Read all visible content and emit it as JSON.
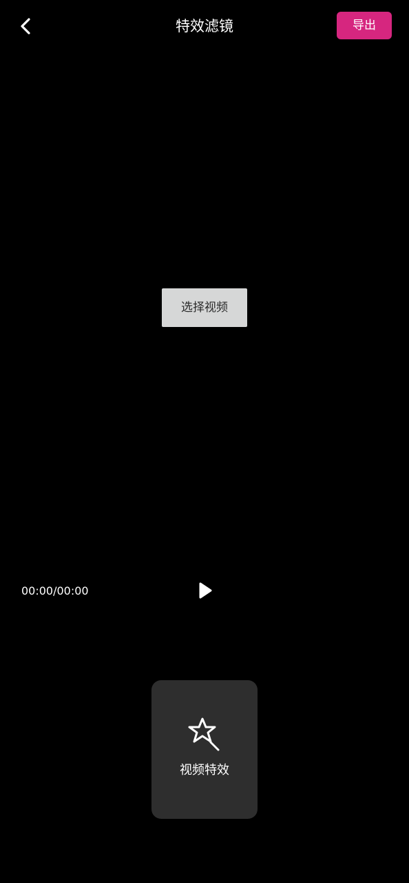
{
  "header": {
    "title": "特效滤镜",
    "export_label": "导出",
    "back_icon": "chevron-left-icon"
  },
  "main": {
    "select_video_label": "选择视频"
  },
  "player": {
    "time_readout": "00:00/00:00",
    "play_icon": "play-icon"
  },
  "bottom_panel": {
    "effects_label": "视频特效",
    "effects_icon": "magic-wand-star-icon"
  },
  "colors": {
    "background": "#000000",
    "accent": "#d6267f",
    "card": "#2e2e2e",
    "select_button": "#d6d7d7"
  }
}
